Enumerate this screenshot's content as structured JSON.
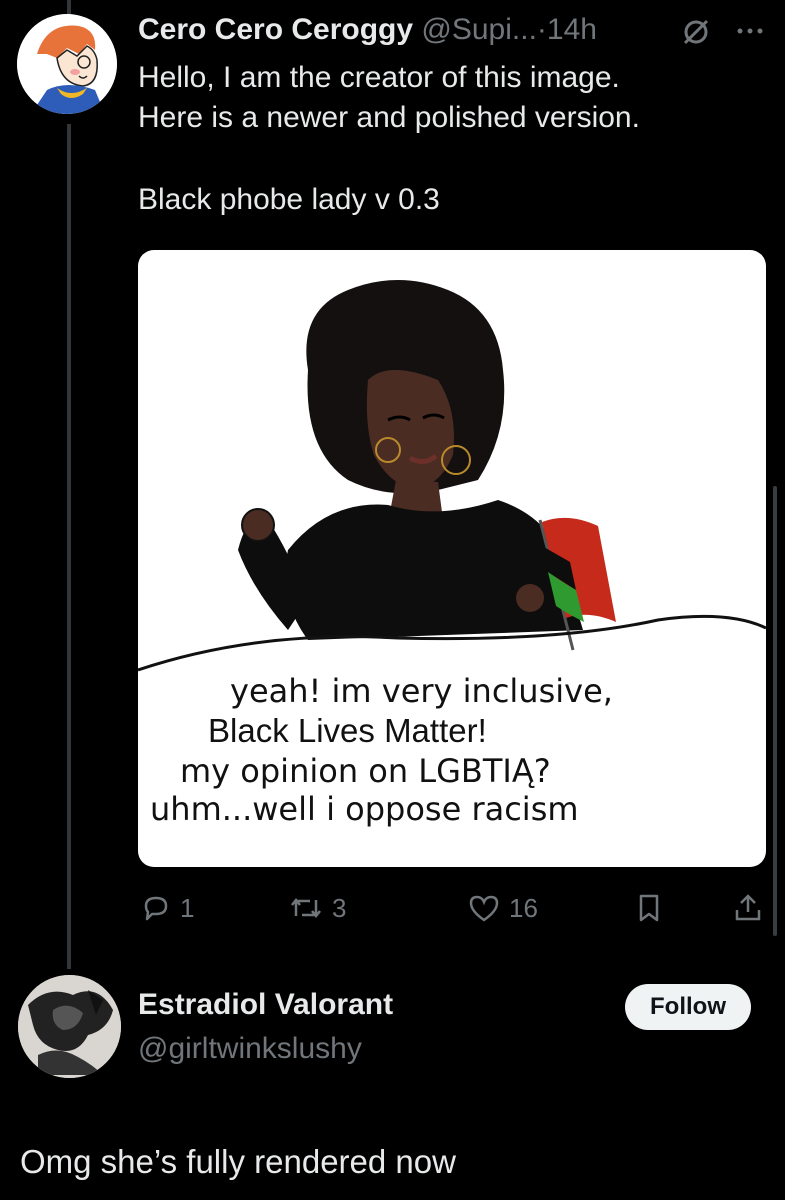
{
  "tweet": {
    "author_name": "Cero Cero Ceroggy",
    "handle": "@Supi...",
    "separator": "·",
    "time": "14h",
    "text_lines": [
      "Hello, I am the creator of this image.",
      "Here is a newer and polished version.",
      "",
      "Black phobe lady v 0.3"
    ],
    "media": {
      "caption_lines": [
        "yeah! im very inclusive,",
        "Black Lives Matter!",
        "my opinion on LGBTIĄ?",
        "uhm...well i oppose racism"
      ]
    },
    "actions": {
      "replies": "1",
      "reposts": "3",
      "likes": "16"
    }
  },
  "reply": {
    "author_name": "Estradiol Valorant",
    "handle": "@girltwinkslushy",
    "follow_label": "Follow",
    "text": "Omg she’s fully rendered now"
  },
  "colors": {
    "background": "#000000",
    "text": "#e7e9ea",
    "muted": "#71767b",
    "follow_bg": "#eff3f4"
  }
}
